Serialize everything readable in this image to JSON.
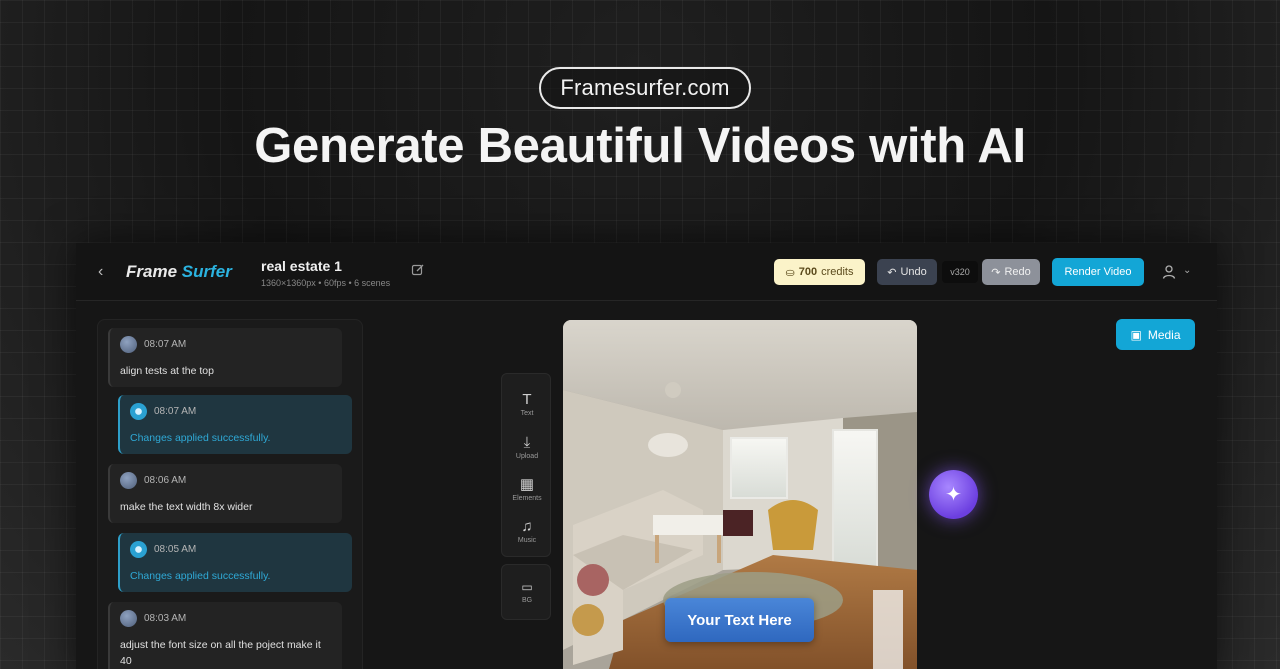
{
  "hero": {
    "brand": "Framesurfer.com",
    "title": "Generate Beautiful Videos with AI"
  },
  "topbar": {
    "back_icon": "chevron-left-icon",
    "logo_part1": "Frame",
    "logo_part2": "Surfer",
    "project_name": "real estate 1",
    "project_meta": "1360×1360px • 60fps • 6 scenes",
    "credits_value": "700",
    "credits_label": "credits",
    "undo_label": "Undo",
    "version": "v320",
    "redo_label": "Redo",
    "render_label": "Render Video"
  },
  "chat": {
    "messages": [
      {
        "role": "user",
        "time": "08:07 AM",
        "text": "align tests at the top"
      },
      {
        "role": "ai",
        "time": "08:07 AM",
        "text": "Changes applied successfully."
      },
      {
        "role": "user",
        "time": "08:06 AM",
        "text": "make the text width 8x wider"
      },
      {
        "role": "ai",
        "time": "08:05 AM",
        "text": "Changes applied successfully."
      },
      {
        "role": "user",
        "time": "08:03 AM",
        "text": "adjust the font size on all the poject make it 40"
      }
    ]
  },
  "tools": {
    "items": [
      {
        "icon": "text-icon",
        "label": "Text"
      },
      {
        "icon": "upload-icon",
        "label": "Upload"
      },
      {
        "icon": "elements-icon",
        "label": "Elements"
      },
      {
        "icon": "music-icon",
        "label": "Music"
      }
    ],
    "bg_label": "BG"
  },
  "canvas": {
    "overlay_text": "Your Text Here"
  },
  "media_label": "Media",
  "colors": {
    "accent": "#13a6d6",
    "magic": "#6c3fe0",
    "credits_bg": "#fbf3c9"
  }
}
